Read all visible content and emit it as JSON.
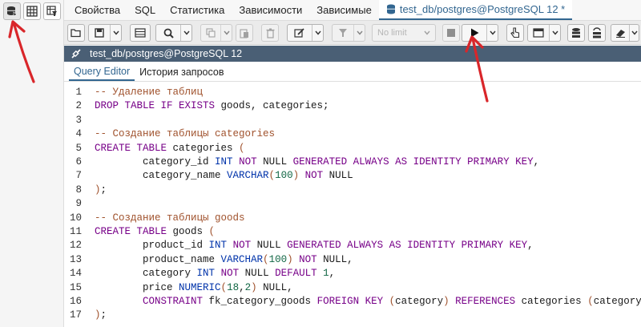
{
  "browser_toolbar": {
    "icons": [
      "query-tool-icon",
      "view-data-icon",
      "filtered-rows-icon"
    ]
  },
  "tabs": [
    {
      "label": "Свойства"
    },
    {
      "label": "SQL"
    },
    {
      "label": "Статистика"
    },
    {
      "label": "Зависимости"
    },
    {
      "label": "Зависимые"
    },
    {
      "label": "test_db/postgres@PostgreSQL 12 *",
      "active": true
    }
  ],
  "toolbar": {
    "limit_label": "No limit"
  },
  "connection": {
    "label": "test_db/postgres@PostgreSQL 12"
  },
  "subtabs": [
    {
      "label": "Query Editor",
      "active": true
    },
    {
      "label": "История запросов"
    }
  ],
  "editor": {
    "line_numbers": [
      "1",
      "2",
      "3",
      "4",
      "5",
      "6",
      "7",
      "8",
      "9",
      "10",
      "11",
      "12",
      "13",
      "14",
      "15",
      "16",
      "17"
    ],
    "lines": [
      [
        {
          "t": "-- Удаление таблиц",
          "c": "cm"
        }
      ],
      [
        {
          "t": "DROP TABLE IF EXISTS",
          "c": "kw"
        },
        {
          "t": " goods, categories;",
          "c": "id"
        }
      ],
      [],
      [
        {
          "t": "-- Создание таблицы categories",
          "c": "cm"
        }
      ],
      [
        {
          "t": "CREATE TABLE",
          "c": "kw"
        },
        {
          "t": " categories ",
          "c": "id"
        },
        {
          "t": "(",
          "c": "pn"
        }
      ],
      [
        {
          "t": "        category_id ",
          "c": "id"
        },
        {
          "t": "INT",
          "c": "ty"
        },
        {
          "t": " ",
          "c": "id"
        },
        {
          "t": "NOT",
          "c": "kw"
        },
        {
          "t": " NULL ",
          "c": "id"
        },
        {
          "t": "GENERATED ALWAYS AS IDENTITY PRIMARY KEY",
          "c": "kw"
        },
        {
          "t": ",",
          "c": "id"
        }
      ],
      [
        {
          "t": "        category_name ",
          "c": "id"
        },
        {
          "t": "VARCHAR",
          "c": "ty"
        },
        {
          "t": "(",
          "c": "pn"
        },
        {
          "t": "100",
          "c": "nm"
        },
        {
          "t": ")",
          "c": "pn"
        },
        {
          "t": " ",
          "c": "id"
        },
        {
          "t": "NOT",
          "c": "kw"
        },
        {
          "t": " NULL",
          "c": "id"
        }
      ],
      [
        {
          "t": ")",
          "c": "pn"
        },
        {
          "t": ";",
          "c": "id"
        }
      ],
      [],
      [
        {
          "t": "-- Создание таблицы goods",
          "c": "cm"
        }
      ],
      [
        {
          "t": "CREATE TABLE",
          "c": "kw"
        },
        {
          "t": " goods ",
          "c": "id"
        },
        {
          "t": "(",
          "c": "pn"
        }
      ],
      [
        {
          "t": "        product_id ",
          "c": "id"
        },
        {
          "t": "INT",
          "c": "ty"
        },
        {
          "t": " ",
          "c": "id"
        },
        {
          "t": "NOT",
          "c": "kw"
        },
        {
          "t": " NULL ",
          "c": "id"
        },
        {
          "t": "GENERATED ALWAYS AS IDENTITY PRIMARY KEY",
          "c": "kw"
        },
        {
          "t": ",",
          "c": "id"
        }
      ],
      [
        {
          "t": "        product_name ",
          "c": "id"
        },
        {
          "t": "VARCHAR",
          "c": "ty"
        },
        {
          "t": "(",
          "c": "pn"
        },
        {
          "t": "100",
          "c": "nm"
        },
        {
          "t": ")",
          "c": "pn"
        },
        {
          "t": " ",
          "c": "id"
        },
        {
          "t": "NOT",
          "c": "kw"
        },
        {
          "t": " NULL,",
          "c": "id"
        }
      ],
      [
        {
          "t": "        category ",
          "c": "id"
        },
        {
          "t": "INT",
          "c": "ty"
        },
        {
          "t": " ",
          "c": "id"
        },
        {
          "t": "NOT",
          "c": "kw"
        },
        {
          "t": " NULL ",
          "c": "id"
        },
        {
          "t": "DEFAULT",
          "c": "kw"
        },
        {
          "t": " ",
          "c": "id"
        },
        {
          "t": "1",
          "c": "nm"
        },
        {
          "t": ",",
          "c": "id"
        }
      ],
      [
        {
          "t": "        price ",
          "c": "id"
        },
        {
          "t": "NUMERIC",
          "c": "ty"
        },
        {
          "t": "(",
          "c": "pn"
        },
        {
          "t": "18",
          "c": "nm"
        },
        {
          "t": ",",
          "c": "id"
        },
        {
          "t": "2",
          "c": "nm"
        },
        {
          "t": ")",
          "c": "pn"
        },
        {
          "t": " NULL,",
          "c": "id"
        }
      ],
      [
        {
          "t": "        ",
          "c": "id"
        },
        {
          "t": "CONSTRAINT",
          "c": "kw"
        },
        {
          "t": " fk_category_goods ",
          "c": "id"
        },
        {
          "t": "FOREIGN KEY",
          "c": "kw"
        },
        {
          "t": " ",
          "c": "id"
        },
        {
          "t": "(",
          "c": "pn"
        },
        {
          "t": "category",
          "c": "id"
        },
        {
          "t": ")",
          "c": "pn"
        },
        {
          "t": " ",
          "c": "id"
        },
        {
          "t": "REFERENCES",
          "c": "kw"
        },
        {
          "t": " categories ",
          "c": "id"
        },
        {
          "t": "(",
          "c": "pn"
        },
        {
          "t": "category_id",
          "c": "id"
        },
        {
          "t": ")",
          "c": "pn"
        }
      ],
      [
        {
          "t": ")",
          "c": "pn"
        },
        {
          "t": ";",
          "c": "id"
        }
      ]
    ]
  },
  "colors": {
    "accent": "#326690",
    "connection_bar": "#4a5f75",
    "annotation_arrow": "#d9262a"
  }
}
